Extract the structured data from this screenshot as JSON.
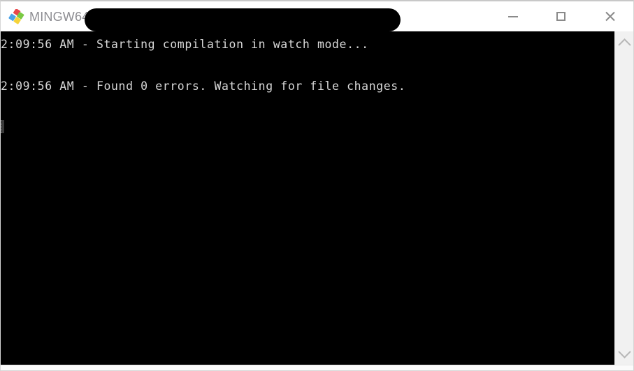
{
  "window": {
    "app_icon": "mingw-diamonds-icon",
    "title": "MINGW64",
    "redacted_title_region": "",
    "controls": {
      "minimize_label": "Minimize",
      "maximize_label": "Maximize",
      "close_label": "Close"
    }
  },
  "terminal": {
    "background_color": "#000000",
    "foreground_color": "#d8d8d8",
    "lines": [
      "2:09:56 AM - Starting compilation in watch mode...",
      "",
      "2:09:56 AM - Found 0 errors. Watching for file changes.",
      ""
    ],
    "cursor": "block-cursor"
  },
  "scrollbar": {
    "up_arrow": "chevron-up-icon",
    "down_arrow": "chevron-down-icon",
    "track_color": "#f1f1f1"
  }
}
